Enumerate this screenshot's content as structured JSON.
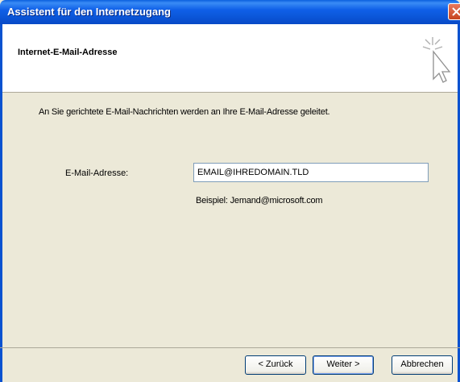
{
  "window": {
    "title": "Assistent für den Internetzugang"
  },
  "header": {
    "title": "Internet-E-Mail-Adresse",
    "icon": "wizard-cursor-icon"
  },
  "body": {
    "intro": "An Sie gerichtete E-Mail-Nachrichten werden an Ihre E-Mail-Adresse geleitet.",
    "email_label": "E-Mail-Adresse:",
    "email_value": "EMAIL@IHREDOMAIN.TLD",
    "example": "Beispiel: Jemand@microsoft.com"
  },
  "buttons": {
    "back": "< Zurück",
    "next": "Weiter >",
    "cancel": "Abbrechen"
  },
  "colors": {
    "titlebar": "#0B56D8",
    "face": "#ECE9D8",
    "close": "#C64520"
  }
}
